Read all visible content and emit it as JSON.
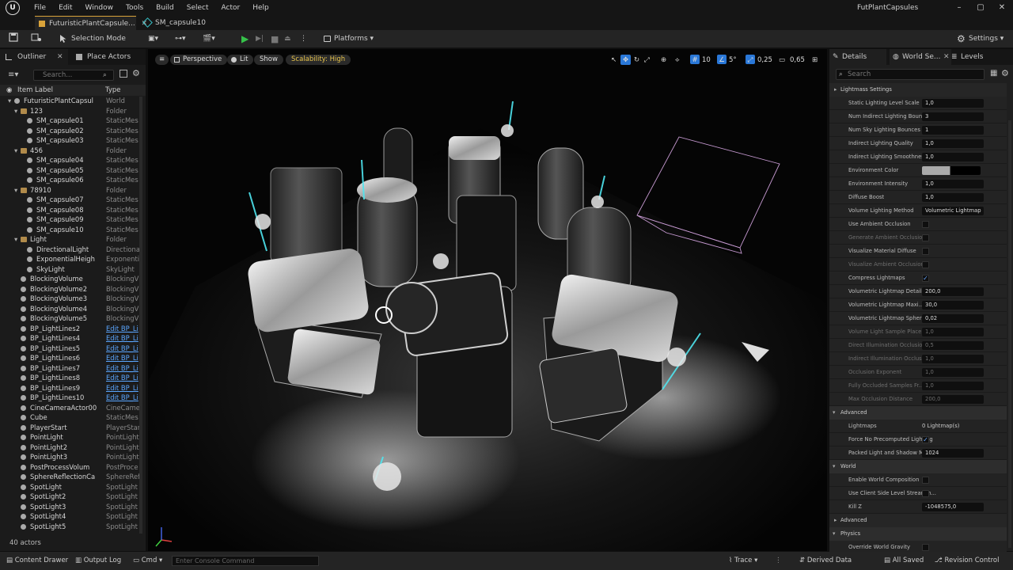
{
  "menubar": {
    "items": [
      "File",
      "Edit",
      "Window",
      "Tools",
      "Build",
      "Select",
      "Actor",
      "Help"
    ],
    "project": "FutPlantCapsules"
  },
  "tabs": [
    {
      "label": "FuturisticPlantCapsule..."
    },
    {
      "label": "SM_capsule10"
    }
  ],
  "toolbar": {
    "selection_mode": "Selection Mode",
    "platforms": "Platforms",
    "settings": "Settings"
  },
  "outliner": {
    "tab_label": "Outliner",
    "place_actors": "Place Actors",
    "search_placeholder": "Search...",
    "col_label": "Item Label",
    "col_type": "Type",
    "rows": [
      {
        "name": "FuturisticPlantCapsul",
        "type": "World",
        "indent": 2,
        "kind": "world"
      },
      {
        "name": "123",
        "type": "Folder",
        "indent": 3,
        "kind": "folder"
      },
      {
        "name": "SM_capsule01",
        "type": "StaticMes",
        "indent": 4,
        "kind": "actor"
      },
      {
        "name": "SM_capsule02",
        "type": "StaticMes",
        "indent": 4,
        "kind": "actor"
      },
      {
        "name": "SM_capsule03",
        "type": "StaticMes",
        "indent": 4,
        "kind": "actor"
      },
      {
        "name": "456",
        "type": "Folder",
        "indent": 3,
        "kind": "folder"
      },
      {
        "name": "SM_capsule04",
        "type": "StaticMes",
        "indent": 4,
        "kind": "actor"
      },
      {
        "name": "SM_capsule05",
        "type": "StaticMes",
        "indent": 4,
        "kind": "actor"
      },
      {
        "name": "SM_capsule06",
        "type": "StaticMes",
        "indent": 4,
        "kind": "actor"
      },
      {
        "name": "78910",
        "type": "Folder",
        "indent": 3,
        "kind": "folder"
      },
      {
        "name": "SM_capsule07",
        "type": "StaticMes",
        "indent": 4,
        "kind": "actor"
      },
      {
        "name": "SM_capsule08",
        "type": "StaticMes",
        "indent": 4,
        "kind": "actor"
      },
      {
        "name": "SM_capsule09",
        "type": "StaticMes",
        "indent": 4,
        "kind": "actor"
      },
      {
        "name": "SM_capsule10",
        "type": "StaticMes",
        "indent": 4,
        "kind": "actor"
      },
      {
        "name": "Light",
        "type": "Folder",
        "indent": 3,
        "kind": "folder"
      },
      {
        "name": "DirectionalLight",
        "type": "Directiona",
        "indent": 4,
        "kind": "actor"
      },
      {
        "name": "ExponentialHeigh",
        "type": "Exponenti",
        "indent": 4,
        "kind": "actor"
      },
      {
        "name": "SkyLight",
        "type": "SkyLight",
        "indent": 4,
        "kind": "actor"
      },
      {
        "name": "BlockingVolume",
        "type": "BlockingV",
        "indent": 3,
        "kind": "actor"
      },
      {
        "name": "BlockingVolume2",
        "type": "BlockingV",
        "indent": 3,
        "kind": "actor"
      },
      {
        "name": "BlockingVolume3",
        "type": "BlockingV",
        "indent": 3,
        "kind": "actor"
      },
      {
        "name": "BlockingVolume4",
        "type": "BlockingV",
        "indent": 3,
        "kind": "actor"
      },
      {
        "name": "BlockingVolume5",
        "type": "BlockingV",
        "indent": 3,
        "kind": "actor"
      },
      {
        "name": "BP_LightLines2",
        "type": "Edit BP_Li",
        "indent": 3,
        "kind": "actor",
        "link": true
      },
      {
        "name": "BP_LightLines4",
        "type": "Edit BP_Li",
        "indent": 3,
        "kind": "actor",
        "link": true
      },
      {
        "name": "BP_LightLines5",
        "type": "Edit BP_Li",
        "indent": 3,
        "kind": "actor",
        "link": true
      },
      {
        "name": "BP_LightLines6",
        "type": "Edit BP_Li",
        "indent": 3,
        "kind": "actor",
        "link": true
      },
      {
        "name": "BP_LightLines7",
        "type": "Edit BP_Li",
        "indent": 3,
        "kind": "actor",
        "link": true
      },
      {
        "name": "BP_LightLines8",
        "type": "Edit BP_Li",
        "indent": 3,
        "kind": "actor",
        "link": true
      },
      {
        "name": "BP_LightLines9",
        "type": "Edit BP_Li",
        "indent": 3,
        "kind": "actor",
        "link": true
      },
      {
        "name": "BP_LightLines10",
        "type": "Edit BP_Li",
        "indent": 3,
        "kind": "actor",
        "link": true
      },
      {
        "name": "CineCameraActor00",
        "type": "CineCame",
        "indent": 3,
        "kind": "actor"
      },
      {
        "name": "Cube",
        "type": "StaticMes",
        "indent": 3,
        "kind": "actor"
      },
      {
        "name": "PlayerStart",
        "type": "PlayerStar",
        "indent": 3,
        "kind": "actor"
      },
      {
        "name": "PointLight",
        "type": "PointLight",
        "indent": 3,
        "kind": "actor"
      },
      {
        "name": "PointLight2",
        "type": "PointLight",
        "indent": 3,
        "kind": "actor"
      },
      {
        "name": "PointLight3",
        "type": "PointLight",
        "indent": 3,
        "kind": "actor"
      },
      {
        "name": "PostProcessVolum",
        "type": "PostProce",
        "indent": 3,
        "kind": "actor"
      },
      {
        "name": "SphereReflectionCa",
        "type": "SphereRef",
        "indent": 3,
        "kind": "actor"
      },
      {
        "name": "SpotLight",
        "type": "SpotLight",
        "indent": 3,
        "kind": "actor"
      },
      {
        "name": "SpotLight2",
        "type": "SpotLight",
        "indent": 3,
        "kind": "actor"
      },
      {
        "name": "SpotLight3",
        "type": "SpotLight",
        "indent": 3,
        "kind": "actor"
      },
      {
        "name": "SpotLight4",
        "type": "SpotLight",
        "indent": 3,
        "kind": "actor"
      },
      {
        "name": "SpotLight5",
        "type": "SpotLight",
        "indent": 3,
        "kind": "actor"
      }
    ],
    "count": "40 actors"
  },
  "viewport": {
    "perspective": "Perspective",
    "lit": "Lit",
    "show": "Show",
    "scalability": "Scalability: High",
    "grid": "10",
    "angle": "5°",
    "scale": "0,25",
    "cam_speed": "0,65"
  },
  "details": {
    "tabs": [
      "Details",
      "World Se...",
      "Levels"
    ],
    "search_placeholder": "Search",
    "rows": [
      {
        "t": "sub",
        "label": "Lightmass Settings"
      },
      {
        "t": "val",
        "label": "Static Lighting Level Scale",
        "value": "1,0"
      },
      {
        "t": "val",
        "label": "Num Indirect Lighting Boun...",
        "value": "3"
      },
      {
        "t": "val",
        "label": "Num Sky Lighting Bounces",
        "value": "1"
      },
      {
        "t": "val",
        "label": "Indirect Lighting Quality",
        "value": "1,0"
      },
      {
        "t": "val",
        "label": "Indirect Lighting Smoothness",
        "value": "1,0"
      },
      {
        "t": "color",
        "label": "Environment Color"
      },
      {
        "t": "val",
        "label": "Environment Intensity",
        "value": "1,0"
      },
      {
        "t": "val",
        "label": "Diffuse Boost",
        "value": "1,0"
      },
      {
        "t": "val",
        "label": "Volume Lighting Method",
        "value": "Volumetric Lightmap"
      },
      {
        "t": "chk",
        "label": "Use Ambient Occlusion",
        "value": ""
      },
      {
        "t": "chk",
        "label": "Generate Ambient Occlusio...",
        "value": "",
        "dim": true
      },
      {
        "t": "chk",
        "label": "Visualize Material Diffuse",
        "value": ""
      },
      {
        "t": "chk",
        "label": "Visualize Ambient Occlusion",
        "value": "",
        "dim": true
      },
      {
        "t": "chk",
        "label": "Compress Lightmaps",
        "value": "✓"
      },
      {
        "t": "val",
        "label": "Volumetric Lightmap Detail...",
        "value": "200,0"
      },
      {
        "t": "val",
        "label": "Volumetric Lightmap Maxi...",
        "value": "30,0"
      },
      {
        "t": "val",
        "label": "Volumetric Lightmap Spheri...",
        "value": "0,02"
      },
      {
        "t": "val",
        "label": "Volume Light Sample Place...",
        "value": "1,0",
        "dim": true
      },
      {
        "t": "val",
        "label": "Direct Illumination Occlusio...",
        "value": "0,5",
        "dim": true
      },
      {
        "t": "val",
        "label": "Indirect Illumination Occlus...",
        "value": "1,0",
        "dim": true
      },
      {
        "t": "val",
        "label": "Occlusion Exponent",
        "value": "1,0",
        "dim": true
      },
      {
        "t": "val",
        "label": "Fully Occluded Samples Fr...",
        "value": "1,0",
        "dim": true
      },
      {
        "t": "val",
        "label": "Max Occlusion Distance",
        "value": "200,0",
        "dim": true
      },
      {
        "t": "sec",
        "label": "Advanced"
      },
      {
        "t": "text",
        "label": "Lightmaps",
        "value": "0 Lightmap(s)"
      },
      {
        "t": "chk",
        "label": "Force No Precomputed Lighting",
        "value": "✓"
      },
      {
        "t": "val",
        "label": "Packed Light and Shadow Map...",
        "value": "1024"
      },
      {
        "t": "sec",
        "label": "World"
      },
      {
        "t": "chk",
        "label": "Enable World Composition",
        "value": ""
      },
      {
        "t": "chk",
        "label": "Use Client Side Level Streamin...",
        "value": ""
      },
      {
        "t": "val",
        "label": "Kill Z",
        "value": "-1048575,0"
      },
      {
        "t": "sub",
        "label": "Advanced"
      },
      {
        "t": "sec",
        "label": "Physics"
      },
      {
        "t": "chk",
        "label": "Override World Gravity",
        "value": ""
      }
    ]
  },
  "statusbar": {
    "content_drawer": "Content Drawer",
    "output_log": "Output Log",
    "cmd": "Cmd",
    "console_placeholder": "Enter Console Command",
    "trace": "Trace",
    "derived_data": "Derived Data",
    "all_saved": "All Saved",
    "revision": "Revision Control"
  }
}
